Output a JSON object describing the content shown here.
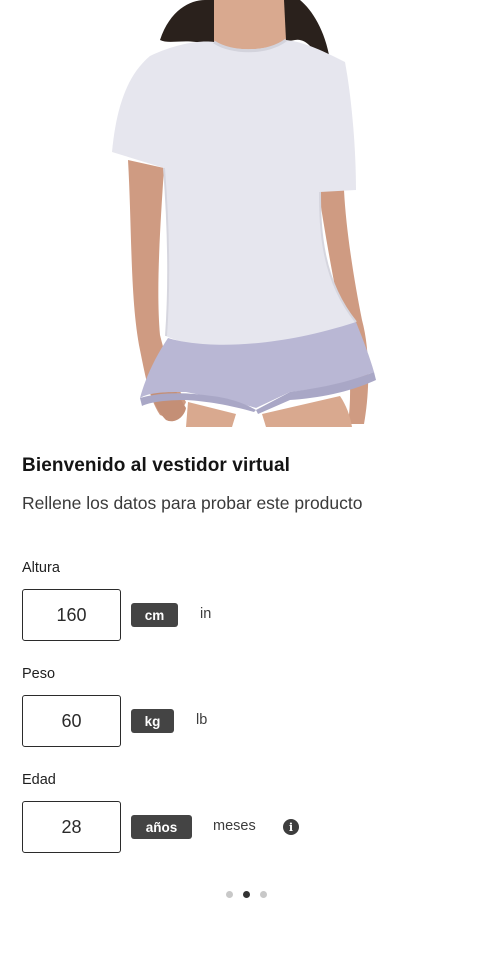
{
  "header": {
    "title": "Bienvenido al vestidor virtual",
    "subtitle": "Rellene los datos para probar este producto"
  },
  "fields": {
    "height": {
      "label": "Altura",
      "value": "160",
      "unit_selected": "cm",
      "unit_other": "in"
    },
    "weight": {
      "label": "Peso",
      "value": "60",
      "unit_selected": "kg",
      "unit_other": "lb"
    },
    "age": {
      "label": "Edad",
      "value": "28",
      "unit_selected": "años",
      "unit_other": "meses",
      "info_icon": "info-icon",
      "info_glyph": "i"
    }
  },
  "pager": {
    "pages": 3,
    "active_page": 2
  },
  "colors": {
    "selected_unit_bg": "#444444",
    "text": "#1a1a1a",
    "dot_active": "#333333",
    "dot_inactive": "#c8c8c8"
  }
}
